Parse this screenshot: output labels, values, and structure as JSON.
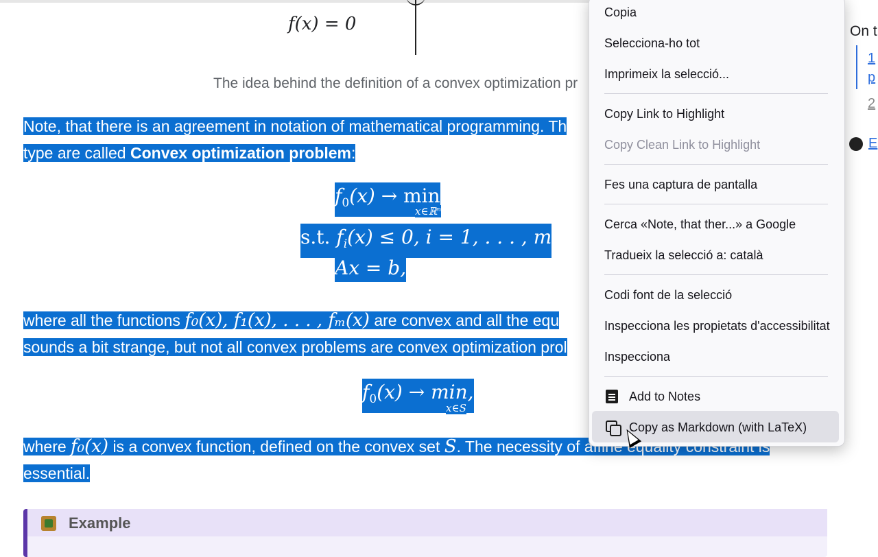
{
  "figure": {
    "equation": "f(x) = 0",
    "caption": "The idea behind the definition of a convex optimization pr"
  },
  "paragraph1": {
    "line1": "Note, that there is an agreement in notation of mathematical programming. Th",
    "line2_prefix": "type are called ",
    "line2_bold": "Convex optimization problem",
    "line2_suffix": ":"
  },
  "problem": {
    "objective_f": "f",
    "objective_sub": "0",
    "objective_arg": "(x)",
    "arrow": "→",
    "min": "min",
    "min_under": "x∈ℝⁿ",
    "st": "s.t.",
    "constraint_f": "f",
    "constraint_sub": "i",
    "constraint_rest": "(x) ≤ 0,  i = 1, . . . , m",
    "affine": "Ax = b,"
  },
  "paragraph2": {
    "line1_prefix": "where all the functions",
    "line1_math": "f₀(x), f₁(x), . . . , fₘ(x)",
    "line1_suffix": "are convex and all the equ",
    "line2": "sounds a bit strange, but not all convex problems are convex optimization prol"
  },
  "problem2": {
    "f": "f",
    "sub": "0",
    "rest": "(x) → min,",
    "under": "x∈S"
  },
  "paragraph3": {
    "prefix": "where",
    "math": "f₀(x)",
    "middle": "is a convex function, defined on the convex set",
    "set": "S",
    "suffix": ". The necessity of affine equality constraint is",
    "line2": "essential."
  },
  "example": {
    "icon": "example-icon",
    "title": "Example"
  },
  "toc": {
    "title": "On th",
    "item1a": "1",
    "item1b": "p",
    "item2": "2",
    "github_icon": "github-icon",
    "github_label": "E"
  },
  "context_menu": {
    "copy": "Copia",
    "select_all": "Selecciona-ho tot",
    "print_selection": "Imprimeix la selecció...",
    "copy_link_highlight": "Copy Link to Highlight",
    "copy_clean_link_highlight": "Copy Clean Link to Highlight",
    "screenshot": "Fes una captura de pantalla",
    "search_google": "Cerca «Note, that ther...» a Google",
    "translate": "Tradueix la selecció a: català",
    "view_source": "Codi font de la selecció",
    "inspect_accessibility": "Inspecciona les propietats d'accessibilitat",
    "inspect": "Inspecciona",
    "add_to_notes": "Add to Notes",
    "copy_markdown": "Copy as Markdown (with LaTeX)",
    "notes_icon": "notes-icon",
    "copy_icon": "copy-icon"
  },
  "colors": {
    "selection": "#0b6fd1",
    "link": "#2f6fde",
    "example_border": "#5b36a8"
  }
}
